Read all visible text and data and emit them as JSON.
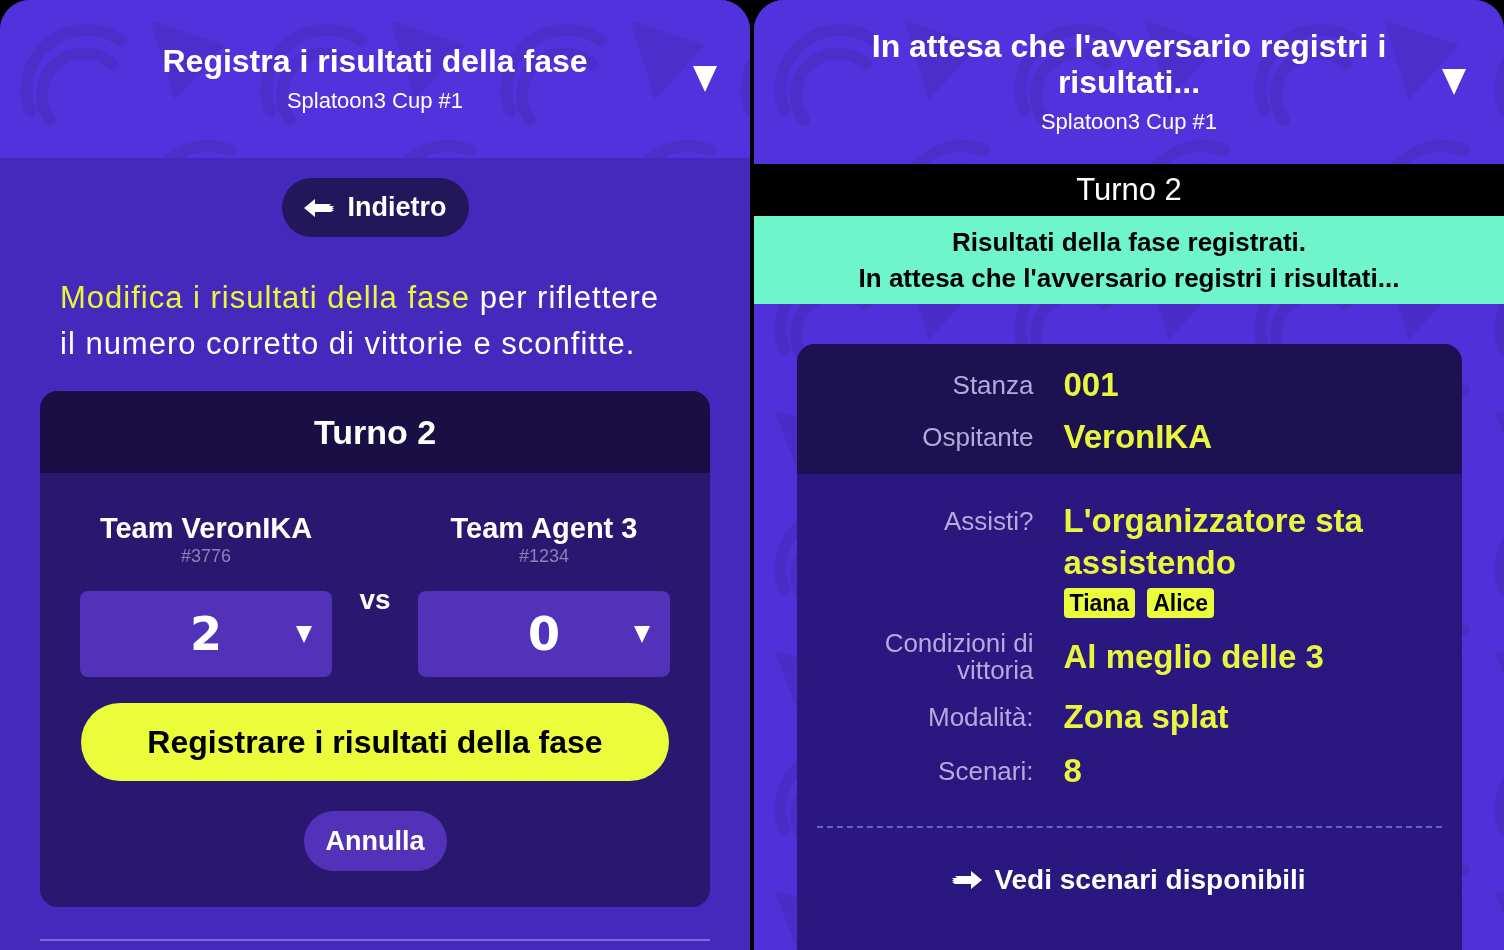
{
  "edit_screen": {
    "header": {
      "title": "Registra i risultati della fase",
      "subtitle": "Splatoon3 Cup #1"
    },
    "back_button": "Indietro",
    "instructions": {
      "highlight": "Modifica i risultati della fase",
      "text": " per riflettere il numero corretto di vittorie e sconfitte."
    },
    "round": {
      "title": "Turno 2",
      "teams": [
        {
          "name": "Team VeronIKA",
          "tag": "#3776",
          "score": "2"
        },
        {
          "name": "Team Agent 3",
          "tag": "#1234",
          "score": "0"
        }
      ],
      "versus": "vs",
      "submit_button": "Registrare i risultati della fase",
      "cancel_button": "Annulla"
    }
  },
  "waiting_screen": {
    "header": {
      "title": "In attesa che l'avversario registri i risultati...",
      "subtitle": "Splatoon3 Cup #1"
    },
    "round_bar": "Turno 2",
    "status_banner": [
      "Risultati della fase registrati.",
      "In attesa che l'avversario registri i risultati..."
    ],
    "room": [
      {
        "label": "Stanza",
        "value": "001"
      },
      {
        "label": "Ospitante",
        "value": "VeronIKA"
      }
    ],
    "details": [
      {
        "label": "Assisti?",
        "value": "L'organizzatore sta assistendo",
        "tags": [
          "Tiana",
          "Alice"
        ]
      },
      {
        "label": "Condizioni di vittoria",
        "value": "Al meglio delle 3"
      },
      {
        "label": "Modalità:",
        "value": "Zona splat"
      },
      {
        "label": "Scenari:",
        "value": "8"
      }
    ],
    "stages_link": "Vedi scenari disponibili"
  }
}
